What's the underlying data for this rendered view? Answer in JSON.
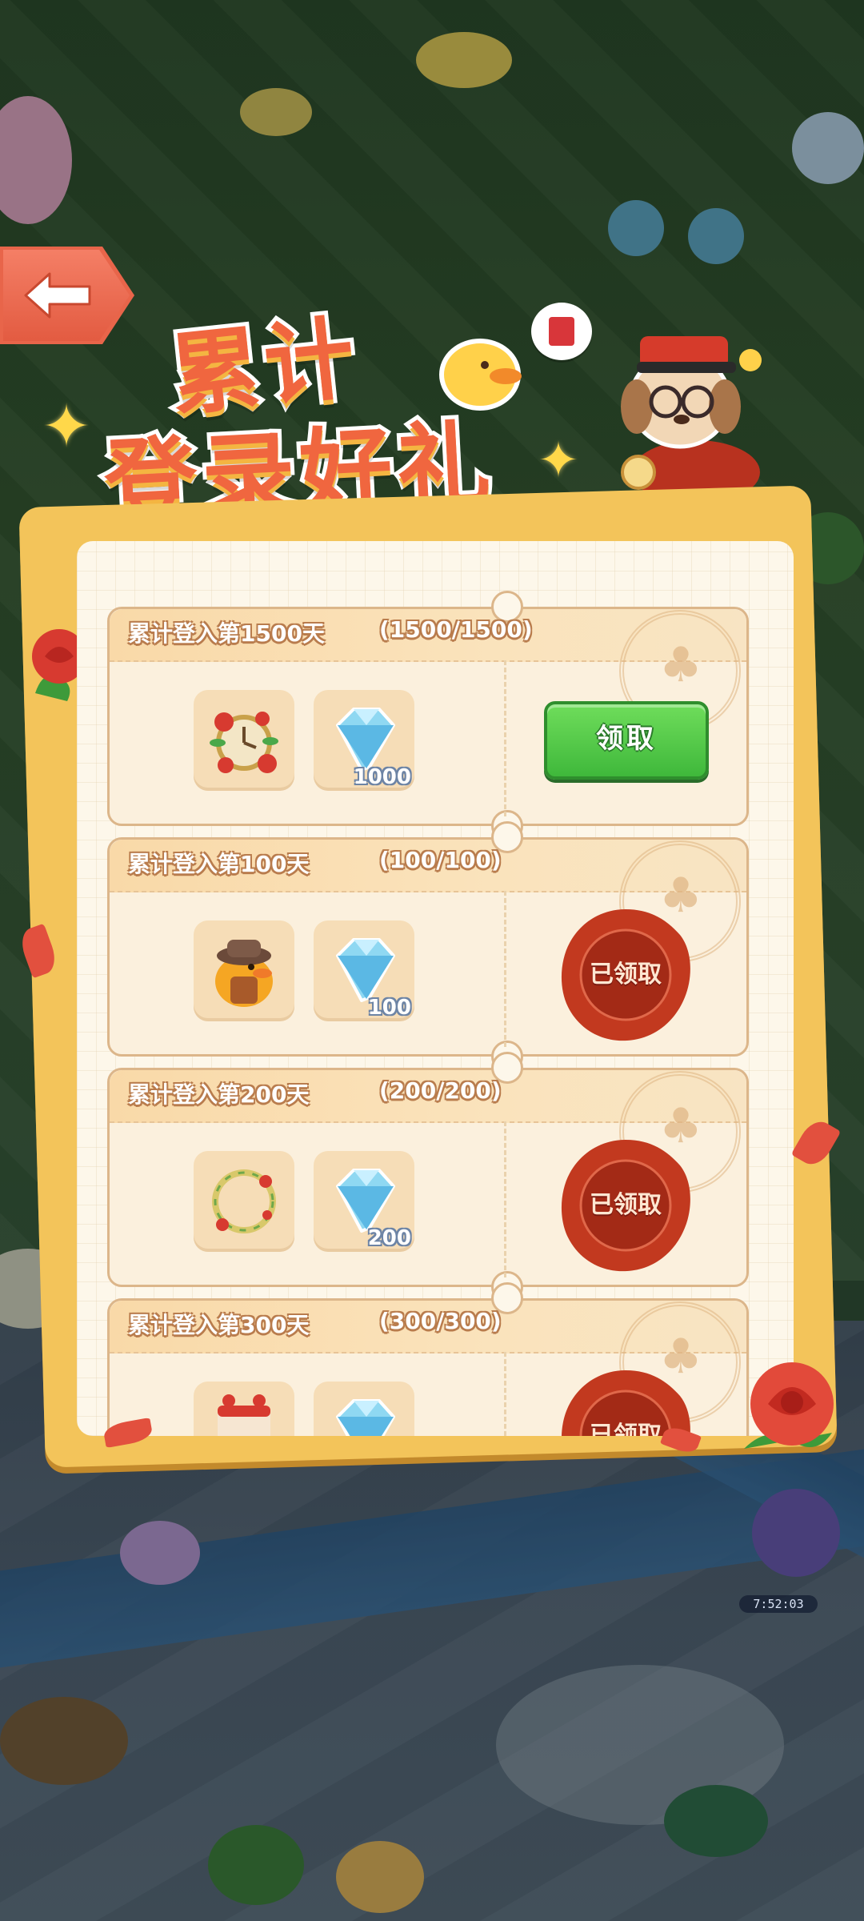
{
  "back_button": {
    "icon": "arrow-left-icon"
  },
  "title": {
    "line1": "累计",
    "line2": "登录好礼"
  },
  "rewards": [
    {
      "title": "累计登入第1500天",
      "progress": "(1500/1500)",
      "items": [
        {
          "icon": "flower-pocket-watch-icon",
          "qty": ""
        },
        {
          "icon": "diamond-icon",
          "qty": "1000"
        }
      ],
      "status": "claim",
      "action_label": "领取"
    },
    {
      "title": "累计登入第100天",
      "progress": "(100/100)",
      "items": [
        {
          "icon": "duck-with-hat-icon",
          "qty": ""
        },
        {
          "icon": "diamond-icon",
          "qty": "100"
        }
      ],
      "status": "claimed",
      "action_label": "已领取"
    },
    {
      "title": "累计登入第200天",
      "progress": "(200/200)",
      "items": [
        {
          "icon": "floral-wreath-icon",
          "qty": ""
        },
        {
          "icon": "diamond-icon",
          "qty": "200"
        }
      ],
      "status": "claimed",
      "action_label": "已领取"
    },
    {
      "title": "累计登入第300天",
      "progress": "(300/300)",
      "items": [
        {
          "icon": "cake-icon",
          "qty": ""
        },
        {
          "icon": "diamond-icon",
          "qty": ""
        }
      ],
      "status": "claimed",
      "action_label": "已领取"
    }
  ],
  "timer": "7:52:03",
  "colors": {
    "claim_green": "#4cc545",
    "seal_red": "#c2391f",
    "title_orange": "#f0663f",
    "panel_gold": "#f3c45a"
  }
}
